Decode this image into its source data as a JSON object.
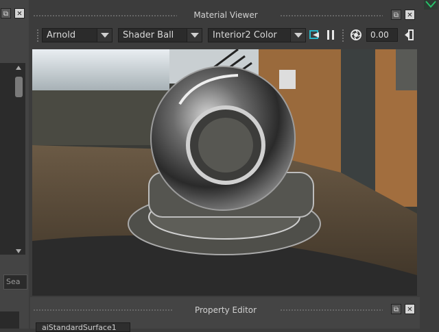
{
  "material_viewer": {
    "title": "Material Viewer",
    "renderer": "Arnold",
    "geometry": "Shader Ball",
    "environment": "Interior2 Color",
    "exposure": "0.00",
    "icons": [
      "refresh-render-icon",
      "pause-icon",
      "exposure-icon",
      "toggle-panel-icon",
      "float-window-icon",
      "close-icon"
    ]
  },
  "property_editor": {
    "title": "Property Editor",
    "tab_label": "aiStandardSurface1"
  },
  "left_panel": {
    "search_placeholder": "Sea"
  },
  "colors": {
    "panel_bg": "#3c3c3c",
    "field_bg": "#2b2b2b",
    "accent_green": "#27c26a"
  }
}
